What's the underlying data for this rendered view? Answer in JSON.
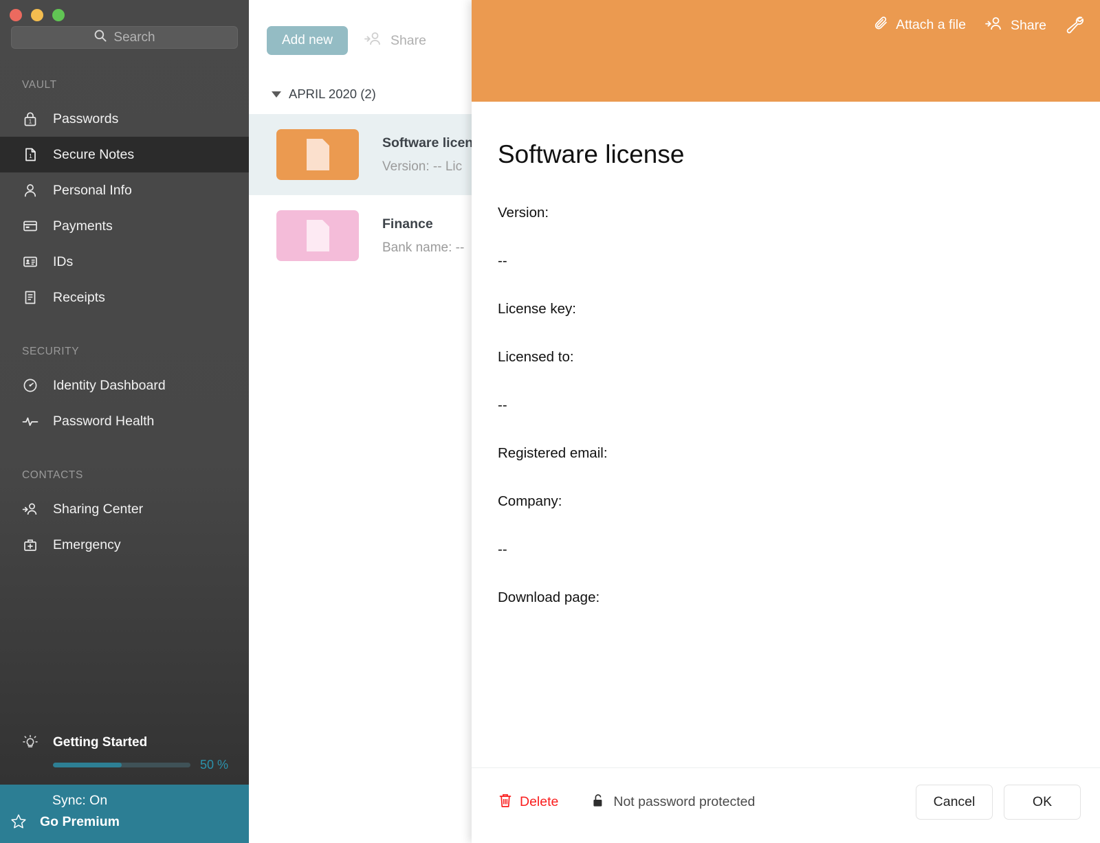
{
  "window": {
    "traffic_lights": [
      {
        "name": "close",
        "color": "#ec6a5f"
      },
      {
        "name": "minimize",
        "color": "#f4bd4f"
      },
      {
        "name": "zoom",
        "color": "#61c554"
      }
    ]
  },
  "search": {
    "placeholder": "Search",
    "value": "",
    "icon": "search-icon"
  },
  "sidebar": {
    "sections": [
      {
        "label": "VAULT",
        "items": [
          {
            "label": "Passwords",
            "icon": "lock-icon",
            "active": false
          },
          {
            "label": "Secure Notes",
            "icon": "note-icon",
            "active": true
          },
          {
            "label": "Personal Info",
            "icon": "person-icon",
            "active": false
          },
          {
            "label": "Payments",
            "icon": "credit-card-icon",
            "active": false
          },
          {
            "label": "IDs",
            "icon": "id-card-icon",
            "active": false
          },
          {
            "label": "Receipts",
            "icon": "receipt-icon",
            "active": false
          }
        ]
      },
      {
        "label": "SECURITY",
        "items": [
          {
            "label": "Identity Dashboard",
            "icon": "gauge-icon",
            "active": false
          },
          {
            "label": "Password Health",
            "icon": "pulse-icon",
            "active": false
          }
        ]
      },
      {
        "label": "CONTACTS",
        "items": [
          {
            "label": "Sharing Center",
            "icon": "share-person-icon",
            "active": false
          },
          {
            "label": "Emergency",
            "icon": "first-aid-icon",
            "active": false
          }
        ]
      }
    ],
    "getting_started": {
      "title": "Getting Started",
      "icon": "lightbulb-icon",
      "percent_label": "50 %",
      "percent_value": 50,
      "fill_color": "#2d7f94",
      "track_color": "#3f5257",
      "text_color": "#2b91ab"
    },
    "footer": {
      "sync_label": "Sync: On",
      "premium_label": "Go Premium",
      "premium_icon": "star-icon",
      "background": "#2c7e94"
    }
  },
  "list_panel": {
    "toolbar": {
      "add_new_label": "Add new",
      "add_new_color": "#94bcc4",
      "share_label": "Share",
      "share_icon": "share-person-icon"
    },
    "group": {
      "caret_icon": "caret-down-icon",
      "title": "APRIL 2020 (2)"
    },
    "rows": [
      {
        "title": "Software license",
        "subtitle": "Version:  --  Lic",
        "thumb_color": "#eb9a50",
        "thumb_glyph_color": "#fbe0cd",
        "icon": "document-icon",
        "selected": true
      },
      {
        "title": "Finance",
        "subtitle": "Bank name:  --",
        "thumb_color": "#f4bcd9",
        "thumb_glyph_color": "#fdeaf3",
        "icon": "document-icon",
        "selected": false
      }
    ]
  },
  "detail": {
    "header": {
      "background": "#eb9a50",
      "actions": [
        {
          "label": "Attach a file",
          "icon": "paperclip-icon"
        },
        {
          "label": "Share",
          "icon": "share-person-icon"
        },
        {
          "label": "",
          "icon": "wrench-icon"
        }
      ]
    },
    "title": "Software license",
    "fields": [
      "Version:",
      "--",
      "License key:",
      "Licensed to:",
      "--",
      "Registered email:",
      "Company:",
      "--",
      "Download page:"
    ],
    "footer": {
      "delete_label": "Delete",
      "delete_icon": "trash-icon",
      "delete_color": "#fa1d1d",
      "password_status_label": "Not password protected",
      "password_status_icon": "unlocked-padlock-icon",
      "cancel_label": "Cancel",
      "ok_label": "OK"
    }
  }
}
